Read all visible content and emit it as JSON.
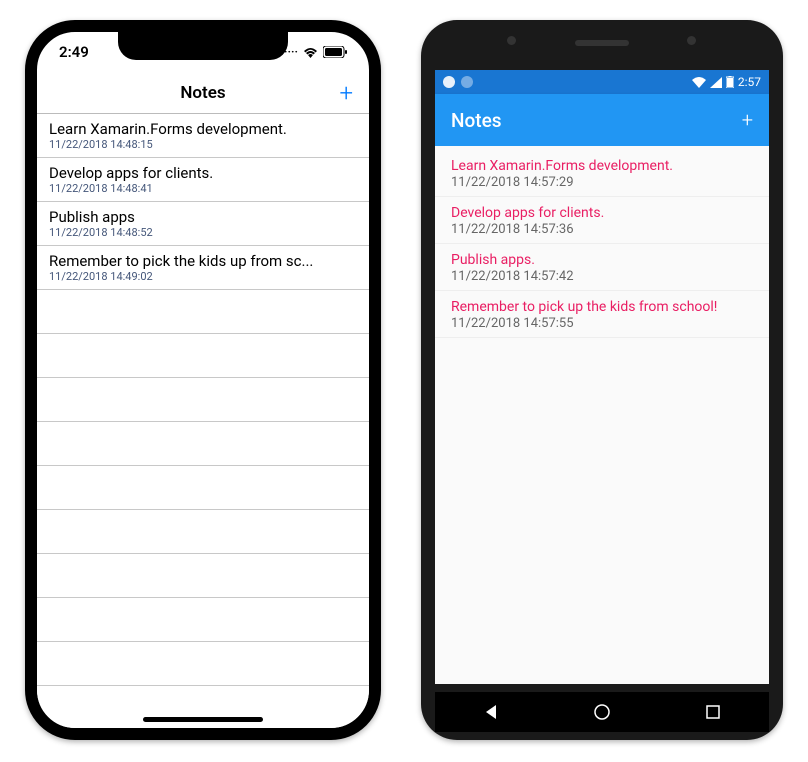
{
  "ios": {
    "statusbar": {
      "time": "2:49",
      "signal": "····",
      "wifi": "wifi",
      "battery": "battery"
    },
    "navbar": {
      "title": "Notes",
      "add": "+"
    },
    "notes": [
      {
        "title": "Learn Xamarin.Forms development.",
        "date": "11/22/2018 14:48:15"
      },
      {
        "title": "Develop apps for clients.",
        "date": "11/22/2018 14:48:41"
      },
      {
        "title": "Publish apps",
        "date": "11/22/2018 14:48:52"
      },
      {
        "title": "Remember to pick the kids up from sc...",
        "date": "11/22/2018 14:49:02"
      }
    ]
  },
  "android": {
    "statusbar": {
      "time": "2:57"
    },
    "appbar": {
      "title": "Notes",
      "add": "+"
    },
    "notes": [
      {
        "title": "Learn Xamarin.Forms development.",
        "date": "11/22/2018 14:57:29"
      },
      {
        "title": "Develop apps for clients.",
        "date": "11/22/2018 14:57:36"
      },
      {
        "title": "Publish apps.",
        "date": "11/22/2018 14:57:42"
      },
      {
        "title": "Remember to pick up the kids from school!",
        "date": "11/22/2018 14:57:55"
      }
    ]
  }
}
